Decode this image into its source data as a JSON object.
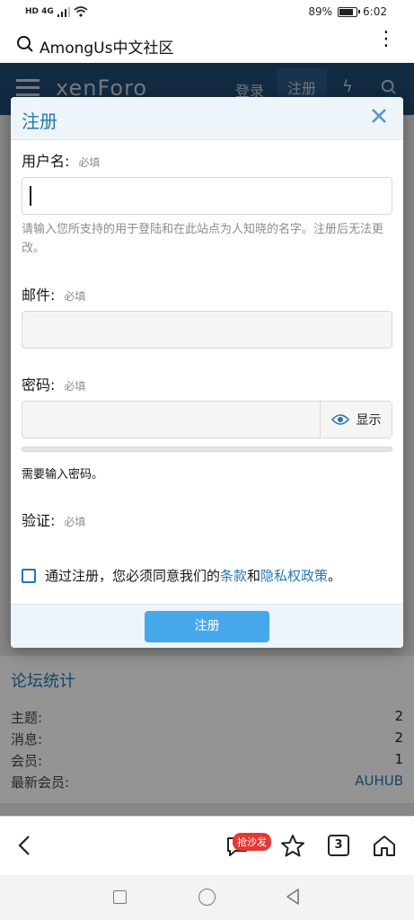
{
  "status_bar": {
    "network": "HD 4G",
    "battery_percent": "89%",
    "battery_level": 0.89,
    "time": "6:02"
  },
  "browser": {
    "title": "AmongUs中文社区",
    "menu_icon": "more-vertical-icon"
  },
  "site_header": {
    "logo": "xenForo",
    "login": "登录",
    "register": "注册"
  },
  "modal": {
    "title": "注册",
    "required": "必填",
    "username": {
      "label": "用户名:",
      "hint": "请输入您所支持的用于登陆和在此站点为人知晓的名字。注册后无法更改。"
    },
    "email": {
      "label": "邮件:"
    },
    "password": {
      "label": "密码:",
      "show_label": "显示",
      "note": "需要输入密码。"
    },
    "verify": {
      "label": "验证:"
    },
    "agree": {
      "prefix": "通过注册，您必须同意我们的",
      "terms": "条款",
      "and": "和",
      "privacy": "隐私权政策",
      "suffix": "。"
    },
    "submit": "注册"
  },
  "stats": {
    "title": "论坛统计",
    "rows": [
      {
        "label": "主题:",
        "value": "2"
      },
      {
        "label": "消息:",
        "value": "2"
      },
      {
        "label": "会员:",
        "value": "1"
      },
      {
        "label": "最新会员:",
        "value": "AUHUB"
      }
    ]
  },
  "toolbar": {
    "badge": "抢沙发",
    "tab_count": "3"
  },
  "colors": {
    "accent": "#2577b1",
    "button": "#47a7eb",
    "header": "#1f4a73"
  }
}
